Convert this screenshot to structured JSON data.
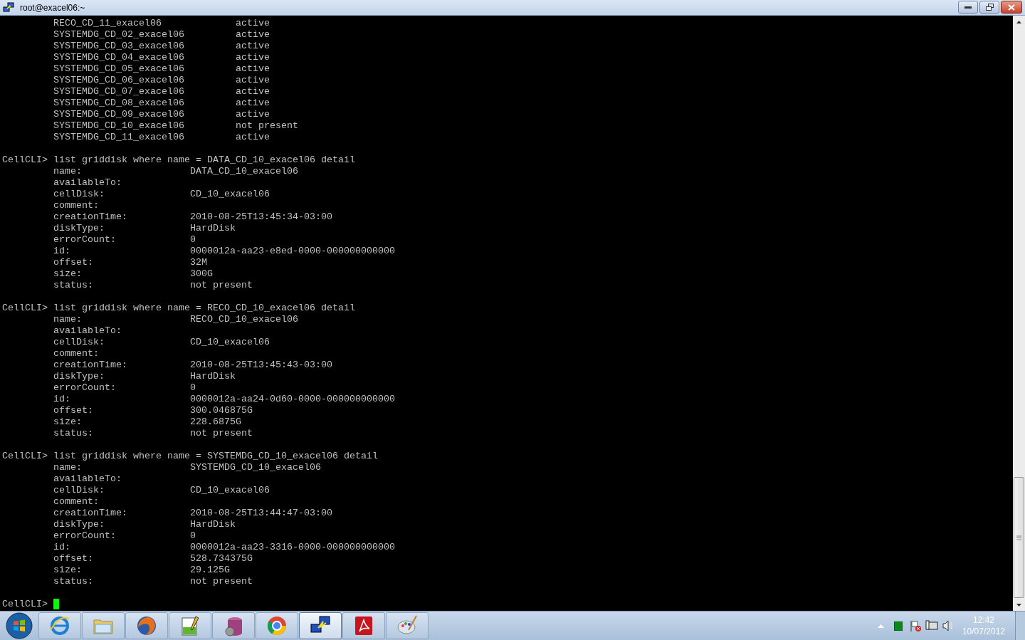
{
  "window": {
    "title": "root@exacel06:~"
  },
  "listing": [
    {
      "name": "RECO_CD_11_exacel06",
      "status": "active"
    },
    {
      "name": "SYSTEMDG_CD_02_exacel06",
      "status": "active"
    },
    {
      "name": "SYSTEMDG_CD_03_exacel06",
      "status": "active"
    },
    {
      "name": "SYSTEMDG_CD_04_exacel06",
      "status": "active"
    },
    {
      "name": "SYSTEMDG_CD_05_exacel06",
      "status": "active"
    },
    {
      "name": "SYSTEMDG_CD_06_exacel06",
      "status": "active"
    },
    {
      "name": "SYSTEMDG_CD_07_exacel06",
      "status": "active"
    },
    {
      "name": "SYSTEMDG_CD_08_exacel06",
      "status": "active"
    },
    {
      "name": "SYSTEMDG_CD_09_exacel06",
      "status": "active"
    },
    {
      "name": "SYSTEMDG_CD_10_exacel06",
      "status": "not present"
    },
    {
      "name": "SYSTEMDG_CD_11_exacel06",
      "status": "active"
    }
  ],
  "commands": [
    {
      "prompt": "CellCLI>",
      "command": "list griddisk where name = DATA_CD_10_exacel06 detail",
      "attributes": [
        {
          "key": "name:",
          "value": "DATA_CD_10_exacel06"
        },
        {
          "key": "availableTo:"
        },
        {
          "key": "cellDisk:",
          "value": "CD_10_exacel06"
        },
        {
          "key": "comment:"
        },
        {
          "key": "creationTime:",
          "value": "2010-08-25T13:45:34-03:00"
        },
        {
          "key": "diskType:",
          "value": "HardDisk"
        },
        {
          "key": "errorCount:",
          "value": "0"
        },
        {
          "key": "id:",
          "value": "0000012a-aa23-e8ed-0000-000000000000"
        },
        {
          "key": "offset:",
          "value": "32M"
        },
        {
          "key": "size:",
          "value": "300G"
        },
        {
          "key": "status:",
          "value": "not present"
        }
      ]
    },
    {
      "prompt": "CellCLI>",
      "command": "list griddisk where name = RECO_CD_10_exacel06 detail",
      "attributes": [
        {
          "key": "name:",
          "value": "RECO_CD_10_exacel06"
        },
        {
          "key": "availableTo:"
        },
        {
          "key": "cellDisk:",
          "value": "CD_10_exacel06"
        },
        {
          "key": "comment:"
        },
        {
          "key": "creationTime:",
          "value": "2010-08-25T13:45:43-03:00"
        },
        {
          "key": "diskType:",
          "value": "HardDisk"
        },
        {
          "key": "errorCount:",
          "value": "0"
        },
        {
          "key": "id:",
          "value": "0000012a-aa24-0d60-0000-000000000000"
        },
        {
          "key": "offset:",
          "value": "300.046875G"
        },
        {
          "key": "size:",
          "value": "228.6875G"
        },
        {
          "key": "status:",
          "value": "not present"
        }
      ]
    },
    {
      "prompt": "CellCLI>",
      "command": "list griddisk where name = SYSTEMDG_CD_10_exacel06 detail",
      "attributes": [
        {
          "key": "name:",
          "value": "SYSTEMDG_CD_10_exacel06"
        },
        {
          "key": "availableTo:"
        },
        {
          "key": "cellDisk:",
          "value": "CD_10_exacel06"
        },
        {
          "key": "comment:"
        },
        {
          "key": "creationTime:",
          "value": "2010-08-25T13:44:47-03:00"
        },
        {
          "key": "diskType:",
          "value": "HardDisk"
        },
        {
          "key": "errorCount:",
          "value": "0"
        },
        {
          "key": "id:",
          "value": "0000012a-aa23-3316-0000-000000000000"
        },
        {
          "key": "offset:",
          "value": "528.734375G"
        },
        {
          "key": "size:",
          "value": "29.125G"
        },
        {
          "key": "status:",
          "value": "not present"
        }
      ]
    }
  ],
  "final_prompt": "CellCLI>",
  "taskbar": {
    "buttons": [
      {
        "kind": "browser-e",
        "active": false
      },
      {
        "kind": "folder",
        "active": false
      },
      {
        "kind": "globe",
        "active": false
      },
      {
        "kind": "notepad",
        "active": false
      },
      {
        "kind": "database",
        "active": false
      },
      {
        "kind": "ring",
        "active": false
      },
      {
        "kind": "terminal",
        "active": true
      },
      {
        "kind": "pdf",
        "active": false
      },
      {
        "kind": "palette",
        "active": false
      }
    ],
    "clock": {
      "time": "12:42",
      "date": "10/07/2012"
    }
  }
}
